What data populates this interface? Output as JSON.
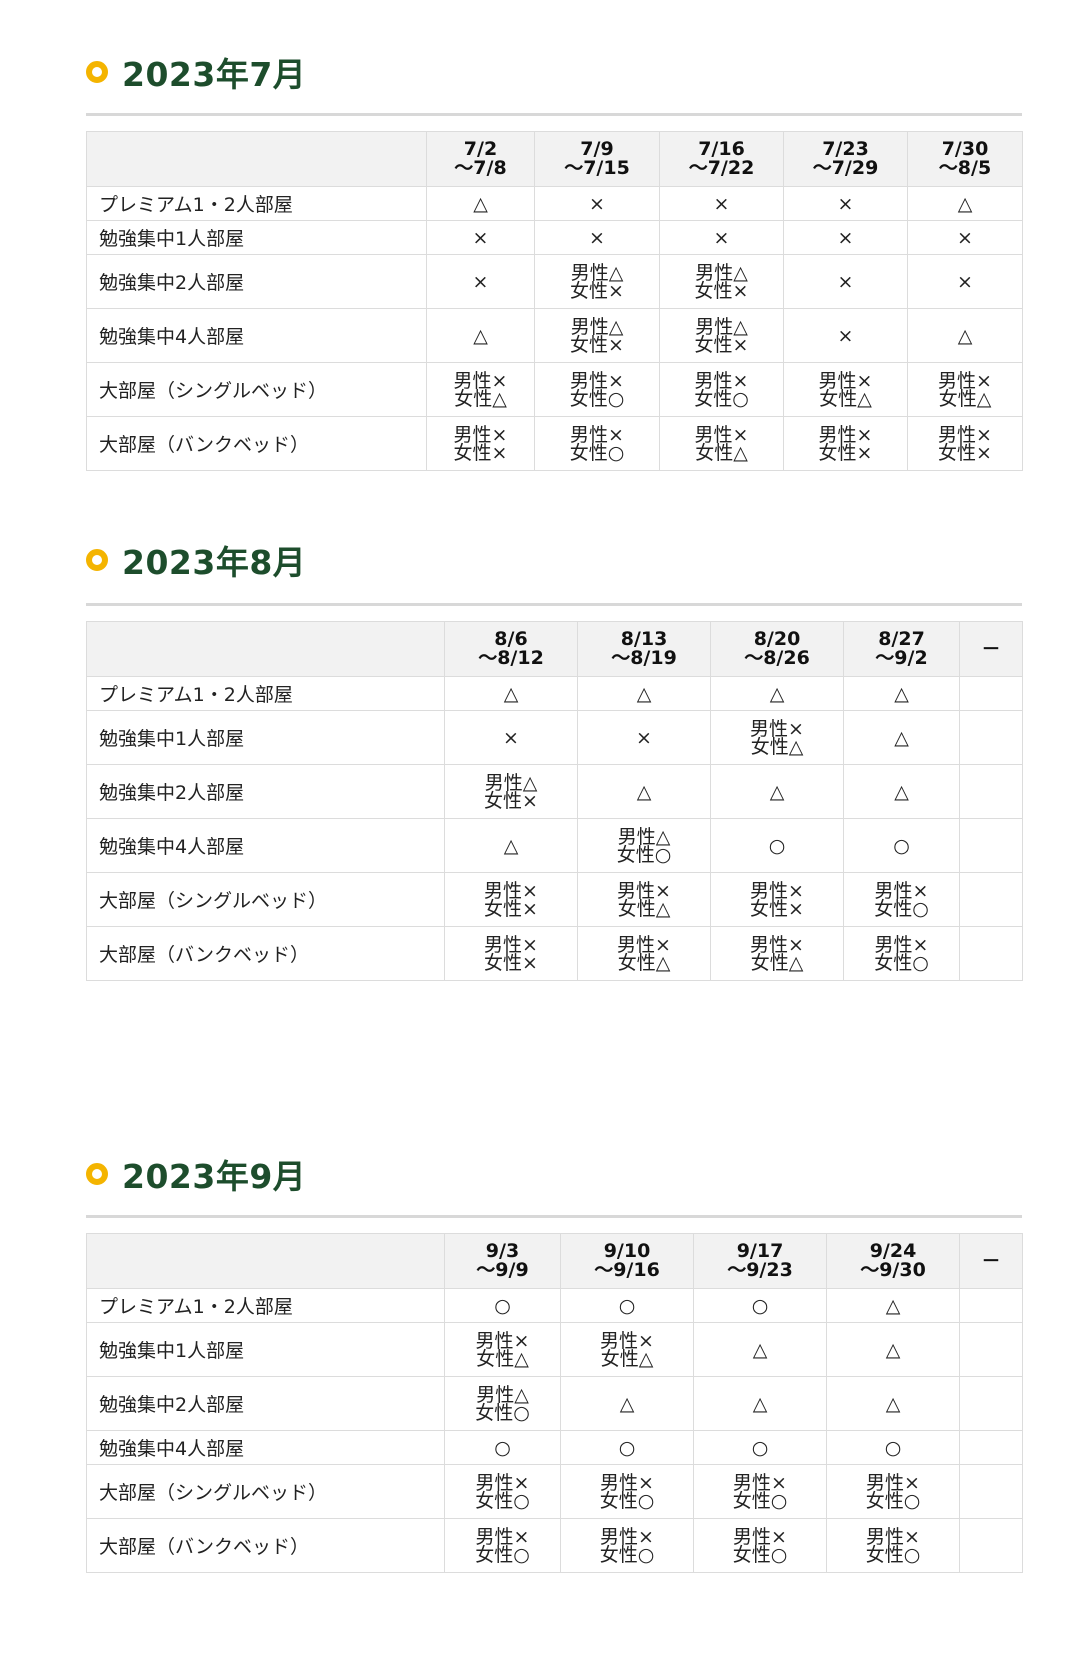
{
  "rooms": [
    "プレミアム1・2人部屋",
    "勉強集中1人部屋",
    "勉強集中2人部屋",
    "勉強集中4人部屋",
    "大部屋（シングルベッド）",
    "大部屋（バンクベッド）"
  ],
  "july": {
    "title": "2023年7月",
    "weeks": [
      [
        "7/2",
        "～7/8"
      ],
      [
        "7/9",
        "～7/15"
      ],
      [
        "7/16",
        "～7/22"
      ],
      [
        "7/23",
        "～7/29"
      ],
      [
        "7/30",
        "～8/5"
      ]
    ],
    "rows": [
      [
        [
          "△"
        ],
        [
          "×"
        ],
        [
          "×"
        ],
        [
          "×"
        ],
        [
          "△"
        ]
      ],
      [
        [
          "×"
        ],
        [
          "×"
        ],
        [
          "×"
        ],
        [
          "×"
        ],
        [
          "×"
        ]
      ],
      [
        [
          "×"
        ],
        [
          "男性△",
          "女性×"
        ],
        [
          "男性△",
          "女性×"
        ],
        [
          "×"
        ],
        [
          "×"
        ]
      ],
      [
        [
          "△"
        ],
        [
          "男性△",
          "女性×"
        ],
        [
          "男性△",
          "女性×"
        ],
        [
          "×"
        ],
        [
          "△"
        ]
      ],
      [
        [
          "男性×",
          "女性△"
        ],
        [
          "男性×",
          "女性○"
        ],
        [
          "男性×",
          "女性○"
        ],
        [
          "男性×",
          "女性△"
        ],
        [
          "男性×",
          "女性△"
        ]
      ],
      [
        [
          "男性×",
          "女性×"
        ],
        [
          "男性×",
          "女性○"
        ],
        [
          "男性×",
          "女性△"
        ],
        [
          "男性×",
          "女性×"
        ],
        [
          "男性×",
          "女性×"
        ]
      ]
    ]
  },
  "august": {
    "title": "2023年8月",
    "weeks": [
      [
        "8/6",
        "～8/12"
      ],
      [
        "8/13",
        "～8/19"
      ],
      [
        "8/20",
        "～8/26"
      ],
      [
        "8/27",
        "～9/2"
      ],
      [
        "－",
        ""
      ]
    ],
    "rows": [
      [
        [
          "△"
        ],
        [
          "△"
        ],
        [
          "△"
        ],
        [
          "△"
        ],
        [
          ""
        ]
      ],
      [
        [
          "×"
        ],
        [
          "×"
        ],
        [
          "男性×",
          "女性△"
        ],
        [
          "△"
        ],
        [
          ""
        ]
      ],
      [
        [
          "男性△",
          "女性×"
        ],
        [
          "△"
        ],
        [
          "△"
        ],
        [
          "△"
        ],
        [
          ""
        ]
      ],
      [
        [
          "△"
        ],
        [
          "男性△",
          "女性○"
        ],
        [
          "○"
        ],
        [
          "○"
        ],
        [
          ""
        ]
      ],
      [
        [
          "男性×",
          "女性×"
        ],
        [
          "男性×",
          "女性△"
        ],
        [
          "男性×",
          "女性×"
        ],
        [
          "男性×",
          "女性○"
        ],
        [
          ""
        ]
      ],
      [
        [
          "男性×",
          "女性×"
        ],
        [
          "男性×",
          "女性△"
        ],
        [
          "男性×",
          "女性△"
        ],
        [
          "男性×",
          "女性○"
        ],
        [
          ""
        ]
      ]
    ]
  },
  "september": {
    "title": "2023年9月",
    "weeks": [
      [
        "9/3",
        "～9/9"
      ],
      [
        "9/10",
        "～9/16"
      ],
      [
        "9/17",
        "～9/23"
      ],
      [
        "9/24",
        "～9/30"
      ],
      [
        "－",
        ""
      ]
    ],
    "rows": [
      [
        [
          "○"
        ],
        [
          "○"
        ],
        [
          "○"
        ],
        [
          "△"
        ],
        [
          ""
        ]
      ],
      [
        [
          "男性×",
          "女性△"
        ],
        [
          "男性×",
          "女性△"
        ],
        [
          "△"
        ],
        [
          "△"
        ],
        [
          ""
        ]
      ],
      [
        [
          "男性△",
          "女性○"
        ],
        [
          "△"
        ],
        [
          "△"
        ],
        [
          "△"
        ],
        [
          ""
        ]
      ],
      [
        [
          "○"
        ],
        [
          "○"
        ],
        [
          "○"
        ],
        [
          "○"
        ],
        [
          ""
        ]
      ],
      [
        [
          "男性×",
          "女性○"
        ],
        [
          "男性×",
          "女性○"
        ],
        [
          "男性×",
          "女性○"
        ],
        [
          "男性×",
          "女性○"
        ],
        [
          ""
        ]
      ],
      [
        [
          "男性×",
          "女性○"
        ],
        [
          "男性×",
          "女性○"
        ],
        [
          "男性×",
          "女性○"
        ],
        [
          "男性×",
          "女性○"
        ],
        [
          ""
        ]
      ]
    ]
  },
  "colors": {
    "accent_ring": "#f4b400",
    "heading": "#1d4d2c",
    "header_bg": "#f2f2f2",
    "border": "#dcdcdc"
  }
}
